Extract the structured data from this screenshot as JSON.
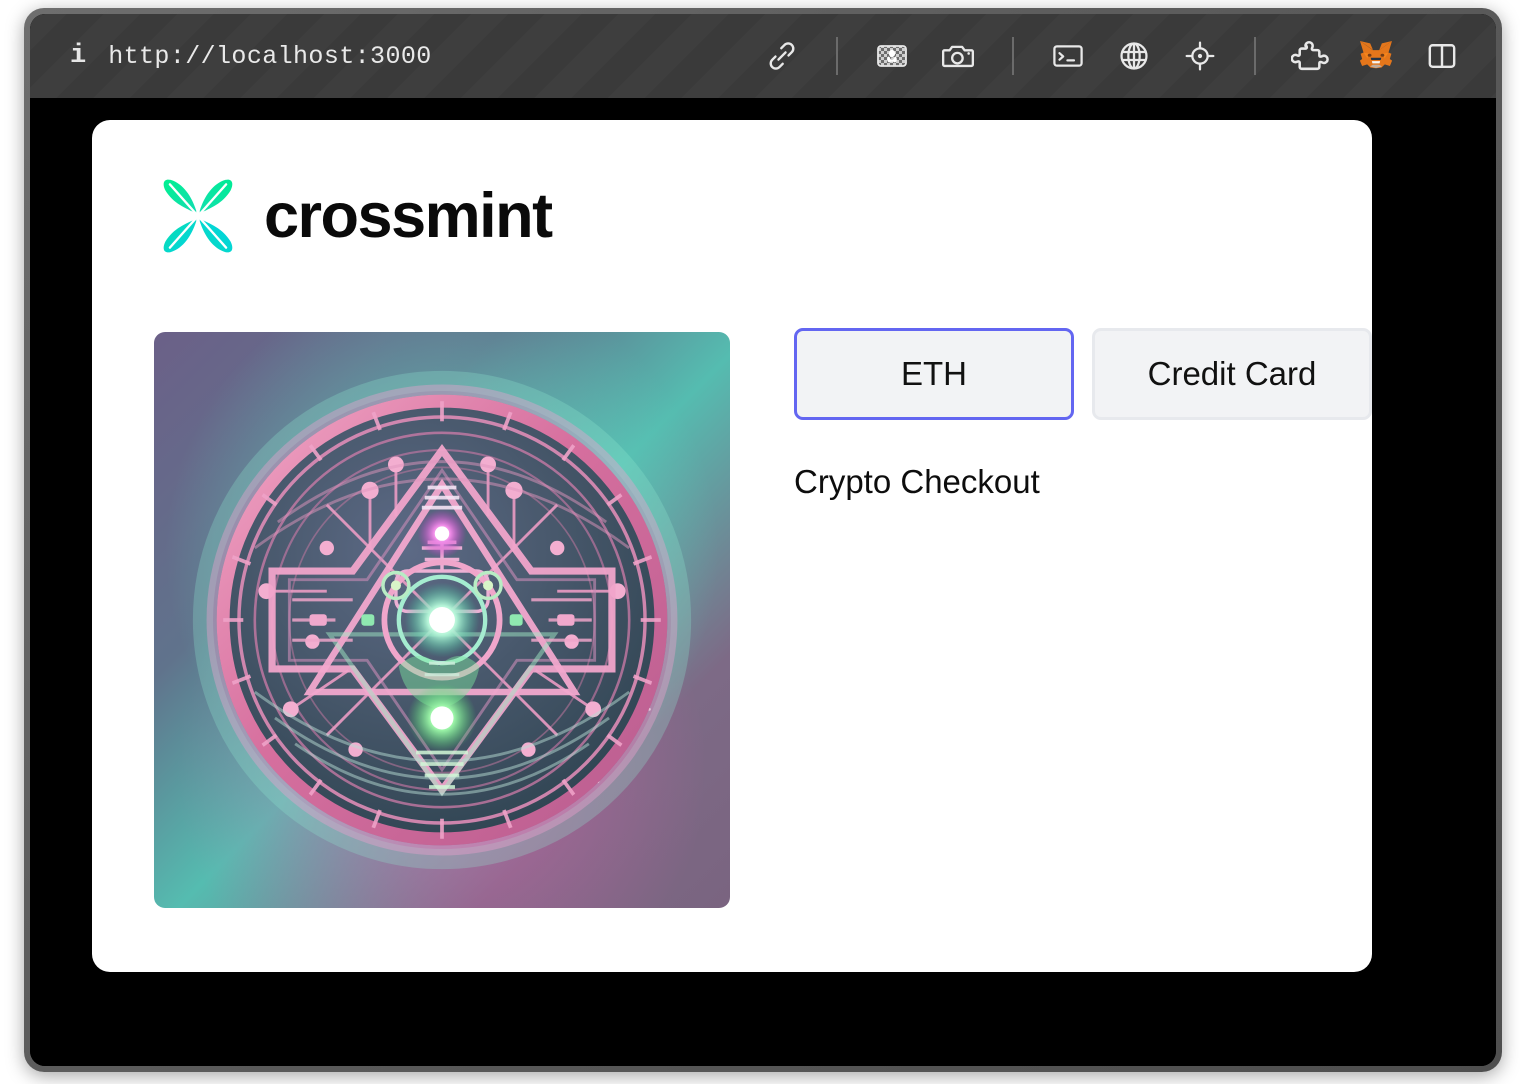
{
  "browser": {
    "url": "http://localhost:3000",
    "info_icon": "info-icon",
    "toolbar_icons": [
      {
        "name": "link-icon",
        "title": "Copy link"
      },
      {
        "name": "image-transparency-icon",
        "title": "Image"
      },
      {
        "name": "camera-icon",
        "title": "Screenshot"
      },
      {
        "name": "terminal-icon",
        "title": "Console"
      },
      {
        "name": "globe-icon",
        "title": "Network"
      },
      {
        "name": "crosshair-icon",
        "title": "Inspect element"
      },
      {
        "name": "puzzle-piece-icon",
        "title": "Extensions"
      },
      {
        "name": "metamask-fox-icon",
        "title": "MetaMask"
      },
      {
        "name": "split-panel-icon",
        "title": "Toggle panel"
      }
    ]
  },
  "page": {
    "brand": {
      "logo_icon": "crossmint-leaf-logo",
      "name": "crossmint",
      "logo_colors": {
        "green": "#00e88f",
        "cyan": "#00d2e8",
        "mid": "#14ddb4"
      }
    },
    "artwork": {
      "alt": "Crypto medallion NFT artwork",
      "background_colors": {
        "purple": "#6f6487",
        "teal": "#55bcb0",
        "mauve": "#7a6480"
      },
      "coin_colors": {
        "rim_pink": "#e48ab4",
        "trace_pink": "#f0a6c8",
        "core_teal": "#3e6a74",
        "glow_green": "#7ef2a0",
        "glow_magenta": "#e455d8"
      }
    },
    "checkout": {
      "methods": [
        {
          "label": "ETH",
          "selected": true
        },
        {
          "label": "Credit Card",
          "selected": false
        }
      ],
      "section_label": "Crypto Checkout",
      "accent_color": "#6366f1",
      "inactive_border_color": "#e7e9ed",
      "button_fill": "#f2f3f5"
    }
  }
}
